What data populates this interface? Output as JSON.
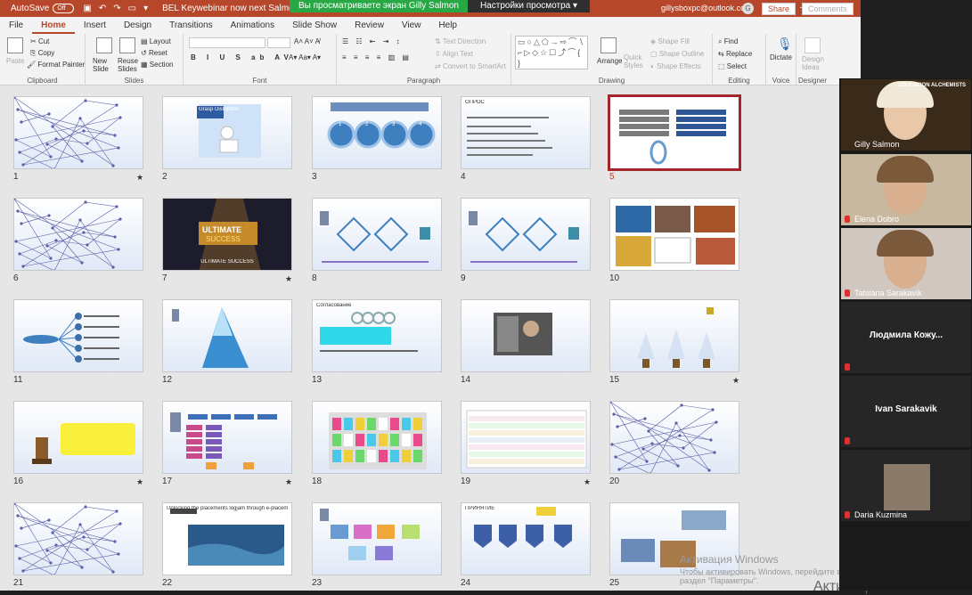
{
  "app": {
    "autosave_label": "AutoSave",
    "autosave_state": "Off",
    "doc_title": "BEL Keywebinar now next Salmon Bl",
    "viewing_banner": "Вы просматриваете экран Gilly Salmon",
    "view_settings": "Настройки просмотра ▾",
    "user_email": "gillysboxpc@outlook.com",
    "avatar_initial": "G"
  },
  "menu": [
    "File",
    "Home",
    "Insert",
    "Design",
    "Transitions",
    "Animations",
    "Slide Show",
    "Review",
    "View",
    "Help"
  ],
  "menu_active": "Home",
  "share_label": "Share",
  "comments_label": "Comments",
  "ribbon": {
    "clipboard": {
      "label": "Clipboard",
      "paste": "Paste",
      "cut": "Cut",
      "copy": "Copy",
      "format_painter": "Format Painter"
    },
    "slides": {
      "label": "Slides",
      "new_slide": "New Slide",
      "reuse_slides": "Reuse Slides",
      "layout": "Layout",
      "reset": "Reset",
      "section": "Section"
    },
    "font": {
      "label": "Font"
    },
    "paragraph": {
      "label": "Paragraph",
      "text_direction": "Text Direction",
      "align_text": "Align Text",
      "convert_smartart": "Convert to SmartArt"
    },
    "drawing": {
      "label": "Drawing",
      "arrange": "Arrange",
      "quick_styles": "Quick Styles",
      "shape_fill": "Shape Fill",
      "shape_outline": "Shape Outline",
      "shape_effects": "Shape Effects"
    },
    "editing": {
      "label": "Editing",
      "find": "Find",
      "replace": "Replace",
      "select": "Select"
    },
    "voice": {
      "label": "Voice",
      "dictate": "Dictate"
    },
    "designer": {
      "label": "Designer",
      "design_ideas": "Design Ideas"
    }
  },
  "slides": [
    {
      "n": "1",
      "star": "★",
      "title": "",
      "style": "network"
    },
    {
      "n": "2",
      "star": "",
      "title": "Grasp Disruption",
      "style": "figure"
    },
    {
      "n": "3",
      "star": "",
      "title": "",
      "style": "circles"
    },
    {
      "n": "4",
      "star": "",
      "title": "ОПРОС",
      "style": "text"
    },
    {
      "n": "5",
      "star": "",
      "title": "",
      "style": "bars"
    },
    {
      "n": "6",
      "star": "",
      "title": "",
      "style": "network"
    },
    {
      "n": "7",
      "star": "★",
      "title": "ULTIMATE SUCCESS",
      "style": "dark"
    },
    {
      "n": "8",
      "star": "",
      "title": "",
      "style": "diamond"
    },
    {
      "n": "9",
      "star": "",
      "title": "",
      "style": "diamond"
    },
    {
      "n": "10",
      "star": "",
      "title": "",
      "style": "photos"
    },
    {
      "n": "11",
      "star": "",
      "title": "",
      "style": "tree"
    },
    {
      "n": "12",
      "star": "",
      "title": "",
      "style": "pyramid"
    },
    {
      "n": "13",
      "star": "",
      "title": "Согласование",
      "style": "gears"
    },
    {
      "n": "14",
      "star": "",
      "title": "",
      "style": "photo"
    },
    {
      "n": "15",
      "star": "★",
      "title": "",
      "style": "lights"
    },
    {
      "n": "16",
      "star": "★",
      "title": "",
      "style": "yellow"
    },
    {
      "n": "17",
      "star": "★",
      "title": "",
      "style": "flow"
    },
    {
      "n": "18",
      "star": "",
      "title": "",
      "style": "keys"
    },
    {
      "n": "19",
      "star": "★",
      "title": "",
      "style": "table"
    },
    {
      "n": "20",
      "star": "",
      "title": "",
      "style": "network"
    },
    {
      "n": "21",
      "star": "",
      "title": "",
      "style": "network"
    },
    {
      "n": "22",
      "star": "",
      "title": "Unlocking the placements logjam through e-placements in healthcare",
      "style": "water"
    },
    {
      "n": "23",
      "star": "",
      "title": "",
      "style": "puzzle"
    },
    {
      "n": "24",
      "star": "",
      "title": "ПРИНЯТИЕ",
      "style": "shields"
    },
    {
      "n": "25",
      "star": "",
      "title": "",
      "style": "photos2"
    }
  ],
  "selected_slide": "5",
  "activation": {
    "title": "Активация Windows",
    "subtitle": "Чтобы активировать Windows, перейдите в раздел \"Параметры\".",
    "ghost": "Активация Windows"
  },
  "participants": [
    {
      "name": "Gilly Salmon",
      "video": true,
      "muted": false,
      "tag": "EDUCATION ALCHEMISTS"
    },
    {
      "name": "Elena Dobro",
      "video": true,
      "muted": true
    },
    {
      "name": "Tatsiana Sarakavik",
      "video": true,
      "muted": true
    },
    {
      "name": "Людмила Кожу...",
      "video": false,
      "muted": true
    },
    {
      "name": "Ivan Sarakavik",
      "video": false,
      "muted": true
    },
    {
      "name": "Daria Kuzmina",
      "video": false,
      "muted": true,
      "avatar": true
    }
  ],
  "colors": {
    "accent": "#b7472a",
    "banner_green": "#28a745",
    "selected": "#a4262c"
  }
}
